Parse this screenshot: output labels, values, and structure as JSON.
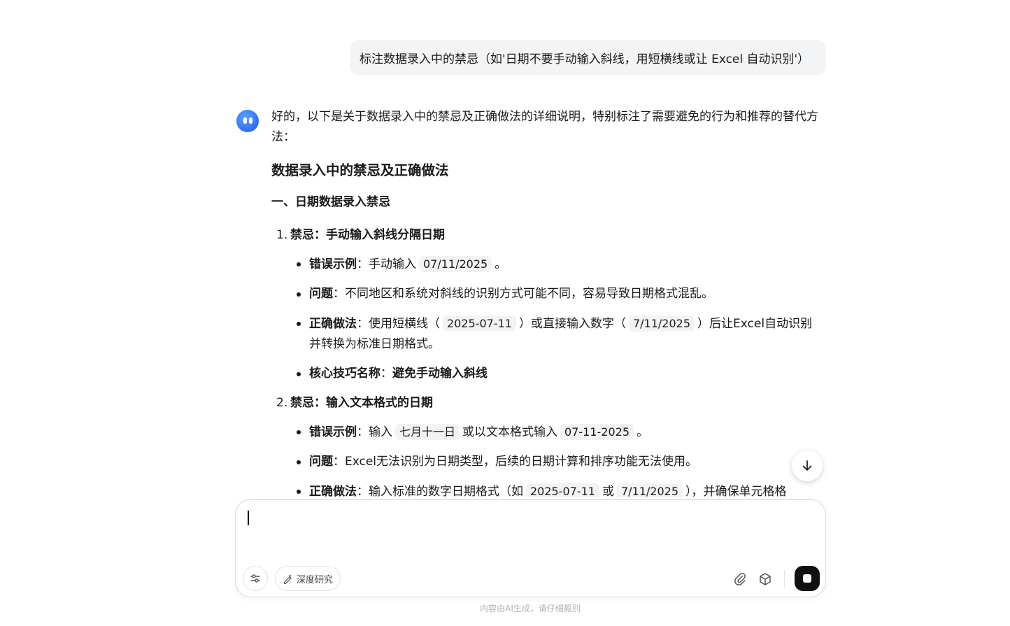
{
  "user_message": {
    "text": "标注数据录入中的禁忌（如'日期不要手动输入斜线，用短横线或让 Excel 自动识别'）"
  },
  "answer": {
    "intro": "好的，以下是关于数据录入中的禁忌及正确做法的详细说明，特别标注了需要避免的行为和推荐的替代方法：",
    "title": "数据录入中的禁忌及正确做法",
    "section1_title": "一、日期数据录入禁忌",
    "items": [
      {
        "num": "1.",
        "title": "禁忌：手动输入斜线分隔日期",
        "bullets": {
          "wrong_label": "错误示例",
          "wrong_text": "：手动输入",
          "wrong_code": "07/11/2025",
          "wrong_tail": "。",
          "problem_label": "问题",
          "problem_text": "：不同地区和系统对斜线的识别方式可能不同，容易导致日期格式混乱。",
          "right_label": "正确做法",
          "right_text1": "：使用短横线（",
          "right_code1": "2025-07-11",
          "right_text2": "）或直接输入数字（",
          "right_code2": "7/11/2025",
          "right_text3": "）后让Excel自动识别并转换为标准日期格式。",
          "tip_label": "核心技巧名称",
          "tip_sep": "：",
          "tip_text": "避免手动输入斜线"
        }
      },
      {
        "num": "2.",
        "title": "禁忌：输入文本格式的日期",
        "bullets": {
          "wrong_label": "错误示例",
          "wrong_text": "：输入",
          "wrong_code1": "七月十一日",
          "wrong_text2": "或以文本格式输入",
          "wrong_code2": "07-11-2025",
          "wrong_tail": "。",
          "problem_label": "问题",
          "problem_text": "：Excel无法识别为日期类型，后续的日期计算和排序功能无法使用。",
          "right_label": "正确做法",
          "right_text1": "：输入标准的数字日期格式（如",
          "right_code1": "2025-07-11",
          "right_text2": "或",
          "right_code2": "7/11/2025",
          "right_text3": "），并确保单元格格"
        }
      }
    ]
  },
  "composer": {
    "placeholder": "",
    "deep_research_label": "深度研究"
  },
  "footer": {
    "note": "内容由AI生成，请仔细甄别"
  },
  "icons": {
    "settings": "sliders-icon",
    "deep_research": "sparkle-pen-icon",
    "attach": "paperclip-icon",
    "model": "cube-icon",
    "stop": "stop-icon",
    "scroll": "arrow-down-icon",
    "avatar": "assistant-avatar-icon"
  }
}
